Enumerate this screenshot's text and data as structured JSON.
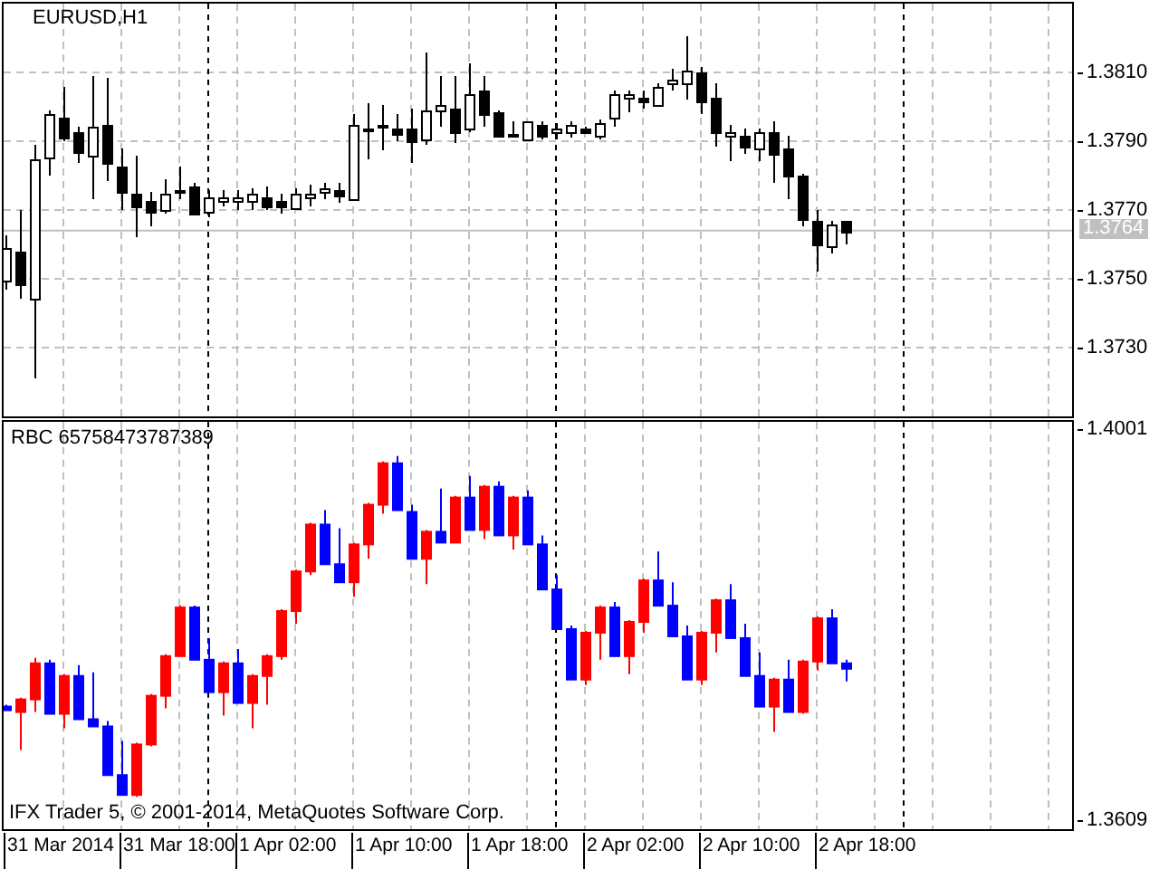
{
  "top_panel": {
    "title": "EURUSD,H1",
    "price_axis": [
      "1.3810",
      "1.3790",
      "1.3770",
      "1.3750",
      "1.3730"
    ],
    "current_price": "1.3764"
  },
  "bottom_panel": {
    "title": "RBC 65758473787389",
    "price_axis": [
      "1.4001",
      "1.3609"
    ],
    "copyright": "IFX Trader 5, © 2001-2014, MetaQuotes Software Corp."
  },
  "time_axis": [
    "31 Mar 2014",
    "31 Mar 18:00",
    "1 Apr 02:00",
    "1 Apr 10:00",
    "1 Apr 18:00",
    "2 Apr 02:00",
    "2 Apr 10:00",
    "2 Apr 18:00"
  ]
}
